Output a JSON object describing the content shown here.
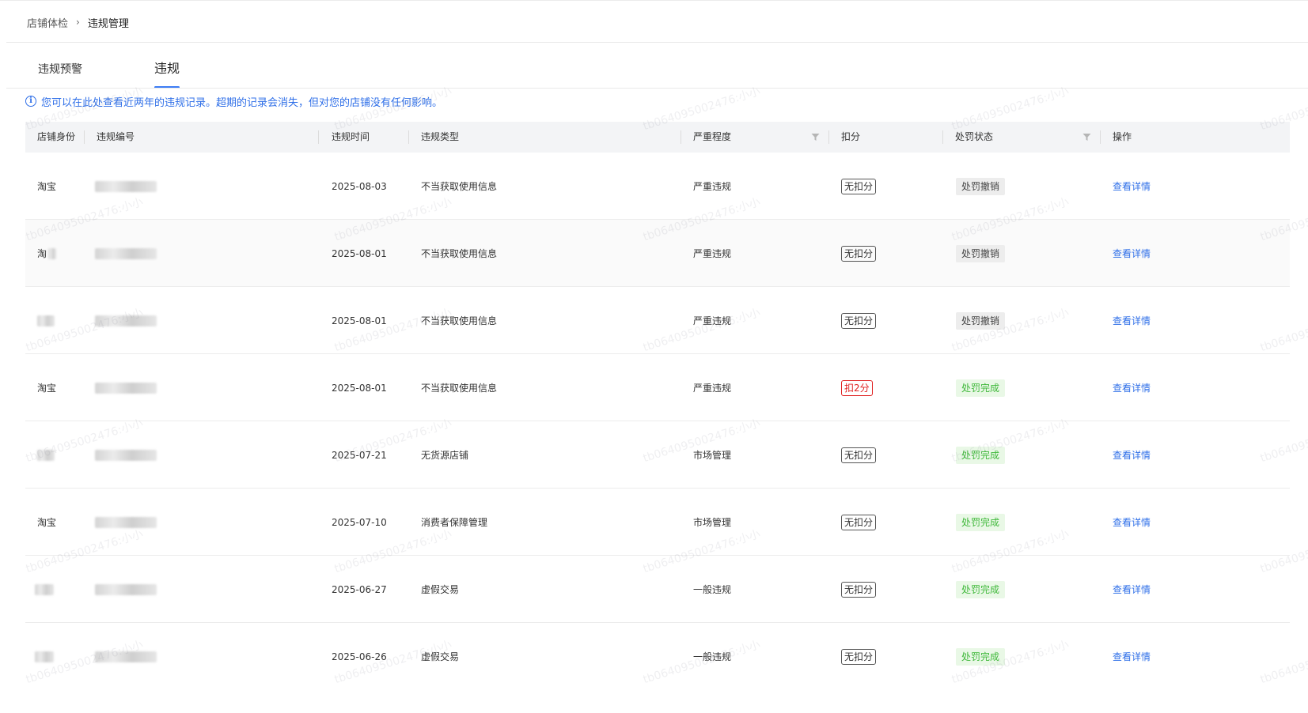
{
  "breadcrumb": {
    "parent": "店铺体检",
    "separator": "›",
    "current": "违规管理"
  },
  "tabs": [
    {
      "label": "违规预警",
      "active": false
    },
    {
      "label": "违规",
      "active": true
    }
  ],
  "notice": {
    "text": "您可以在此处查看近两年的违规记录。超期的记录会消失，但对您的店铺没有任何影响。"
  },
  "table": {
    "columns": [
      "店铺身份",
      "违规编号",
      "违规时间",
      "违规类型",
      "严重程度",
      "扣分",
      "处罚状态",
      "操作"
    ],
    "filterable": [
      "严重程度",
      "处罚状态"
    ],
    "rows": [
      {
        "shop": "淘宝",
        "date": "2025-08-03",
        "type": "不当获取使用信息",
        "severity": "严重违规",
        "deduction": "无扣分",
        "status": "处罚撤销",
        "action": "查看详情"
      },
      {
        "shop": "淘",
        "date": "2025-08-01",
        "type": "不当获取使用信息",
        "severity": "严重违规",
        "deduction": "无扣分",
        "status": "处罚撤销",
        "action": "查看详情"
      },
      {
        "shop": "",
        "date": "2025-08-01",
        "type": "不当获取使用信息",
        "severity": "严重违规",
        "deduction": "无扣分",
        "status": "处罚撤销",
        "action": "查看详情"
      },
      {
        "shop": "淘宝",
        "date": "2025-08-01",
        "type": "不当获取使用信息",
        "severity": "严重违规",
        "deduction": "扣2分",
        "status": "处罚完成",
        "action": "查看详情"
      },
      {
        "shop": "",
        "date": "2025-07-21",
        "type": "无货源店铺",
        "severity": "市场管理",
        "deduction": "无扣分",
        "status": "处罚完成",
        "action": "查看详情"
      },
      {
        "shop": "淘宝",
        "date": "2025-07-10",
        "type": "消费者保障管理",
        "severity": "市场管理",
        "deduction": "无扣分",
        "status": "处罚完成",
        "action": "查看详情"
      },
      {
        "shop": "",
        "date": "2025-06-27",
        "type": "虚假交易",
        "severity": "一般违规",
        "deduction": "无扣分",
        "status": "处罚完成",
        "action": "查看详情"
      },
      {
        "shop": "",
        "date": "2025-06-26",
        "type": "虚假交易",
        "severity": "一般违规",
        "deduction": "无扣分",
        "status": "处罚完成",
        "action": "查看详情"
      }
    ]
  },
  "watermark": "tb064095002476:小小",
  "colors": {
    "accent": "#3d7df5",
    "link": "#2f6fe8",
    "danger": "#e02020",
    "success": "#3fb83a"
  },
  "icons": {
    "breadcrumb_separator": "chevron-right-icon",
    "notice": "info-icon",
    "filter": "filter-icon"
  }
}
